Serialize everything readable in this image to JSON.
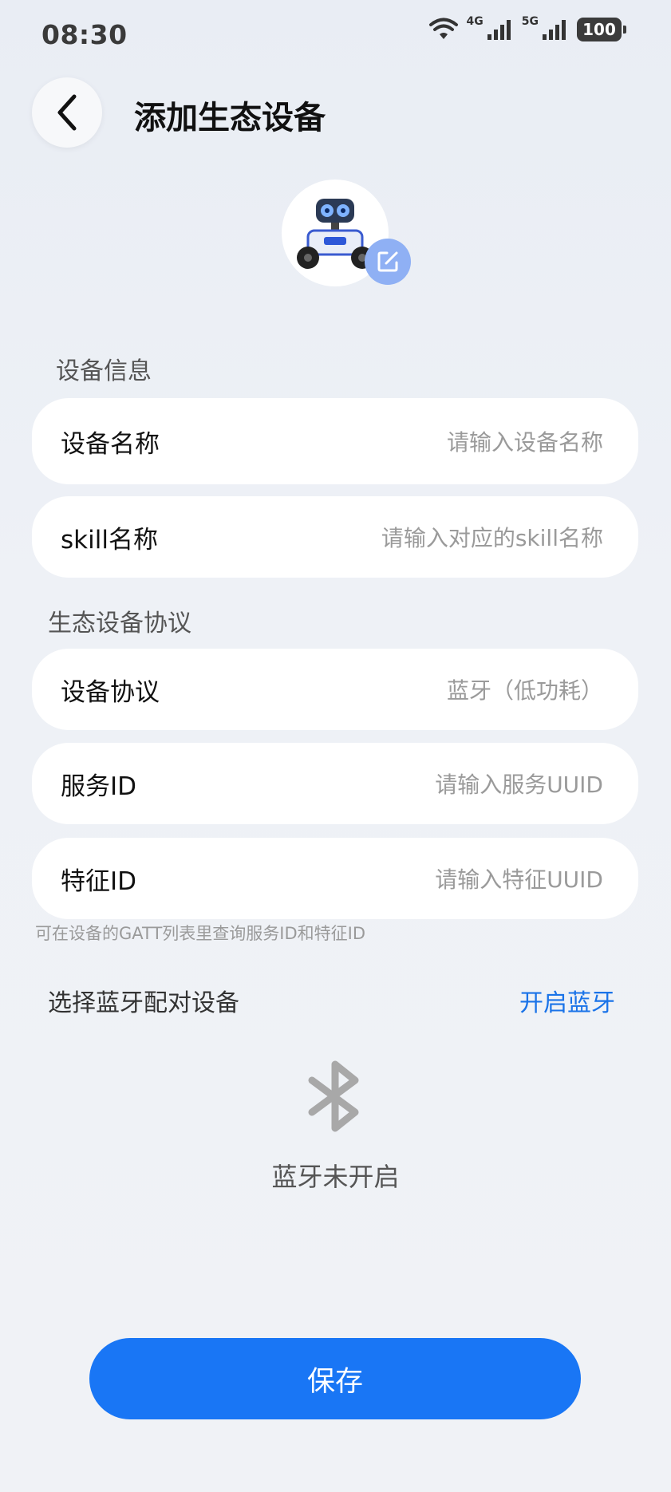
{
  "status_bar": {
    "time": "08:30",
    "net_4g": "4G",
    "net_5g": "5G",
    "battery": "100"
  },
  "header": {
    "title": "添加生态设备"
  },
  "device_info": {
    "section_label": "设备信息",
    "device_name": {
      "label": "设备名称",
      "placeholder": "请输入设备名称"
    },
    "skill_name": {
      "label": "skill名称",
      "placeholder": "请输入对应的skill名称"
    }
  },
  "protocol": {
    "section_label": "生态设备协议",
    "device_protocol": {
      "label": "设备协议",
      "value": "蓝牙（低功耗）"
    },
    "service_id": {
      "label": "服务ID",
      "placeholder": "请输入服务UUID"
    },
    "characteristic_id": {
      "label": "特征ID",
      "placeholder": "请输入特征UUID"
    },
    "hint": "可在设备的GATT列表里查询服务ID和特征ID"
  },
  "bluetooth": {
    "select_label": "选择蓝牙配对设备",
    "open_link": "开启蓝牙",
    "status": "蓝牙未开启"
  },
  "actions": {
    "save": "保存"
  },
  "colors": {
    "accent": "#1976f5",
    "link": "#1a73e8"
  }
}
